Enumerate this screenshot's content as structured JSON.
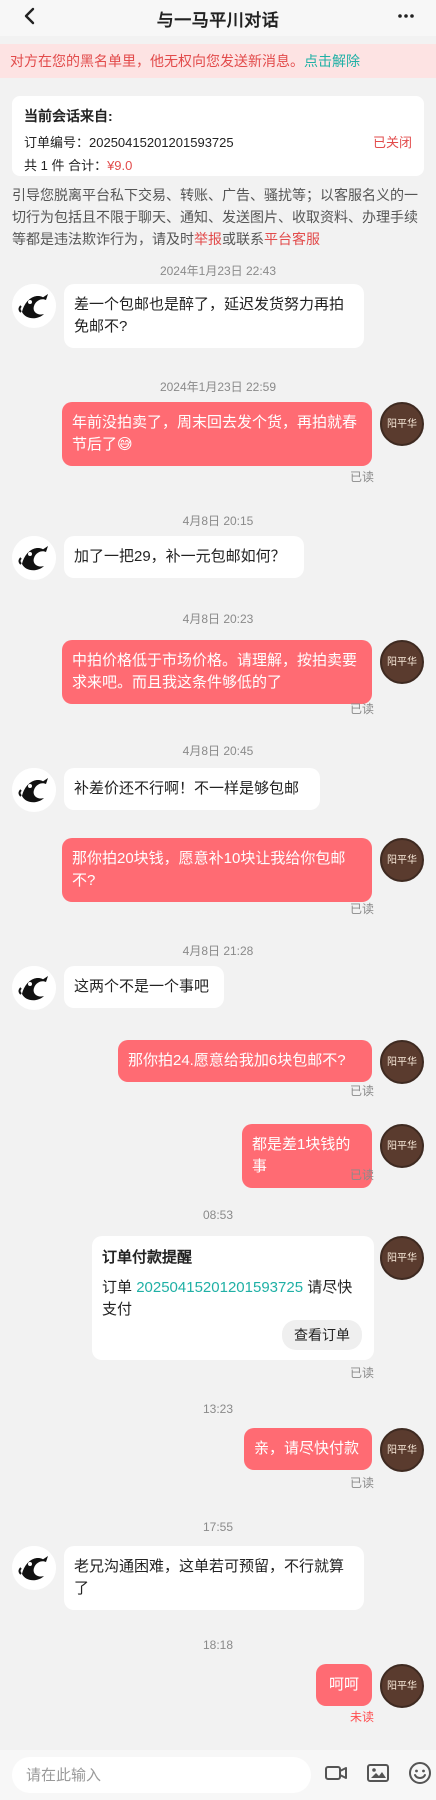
{
  "header": {
    "title": "与一马平川对话"
  },
  "banner": {
    "text": "对方在您的黑名单里，他无权向您发送新消息。",
    "action": "点击解除"
  },
  "order_card": {
    "source_label": "当前会话来自:",
    "order_no_label": "订单编号：",
    "order_no": "2025041520120159​3725",
    "status": "已关闭",
    "qty_total": "共 1 件 合计：",
    "price": "¥9.0"
  },
  "warning": {
    "text_1": "引导您脱离平台私下交易、转账、广告、骚扰等；以客服名义的一切行为包括且不限于聊天、通知、发送图片、收取资料、办理手续等都是违法欺诈行为，请及时",
    "report": "举报",
    "text_2": "或联系",
    "service": "平台客服"
  },
  "messages": [
    {
      "time": "2024年1月23日 22:43"
    },
    {
      "text": "差一个包邮也是醉了，延迟发货努力再拍免邮不?"
    },
    {
      "time": "2024年1月23日 22:59"
    },
    {
      "text": "年前没拍卖了，周末回去发个货，再拍就春节后了😅",
      "status": "已读"
    },
    {
      "time": "4月8日 20:15"
    },
    {
      "text": "加了一把29，补一元包邮如何？"
    },
    {
      "time": "4月8日 20:23"
    },
    {
      "text": "中拍价格低于市场价格。请理解，按拍卖要求来吧。而且我这条件够低的了",
      "status": "已读"
    },
    {
      "time": "4月8日 20:45"
    },
    {
      "text": "补差价还不行啊！不一样是够包邮"
    },
    {
      "text": "那你拍20块钱，愿意补10块让我给你包邮不?",
      "status": "已读"
    },
    {
      "time": "4月8日 21:28"
    },
    {
      "text": "这两个不是一个事吧"
    },
    {
      "text": "那你拍24.愿意给我加6块包邮不?",
      "status": "已读"
    },
    {
      "text": "都是差1块钱的事",
      "status": "已读"
    },
    {
      "time": "08:53"
    },
    {
      "reminder_title": "订单付款提醒",
      "reminder_prefix": "订单",
      "reminder_order": "2025041520120159​3725",
      "reminder_suffix": "请尽快支付",
      "reminder_button": "查看订单",
      "status": "已读"
    },
    {
      "time": "13:23"
    },
    {
      "text": "亲，请尽快付款",
      "status": "已读"
    },
    {
      "time": "17:55"
    },
    {
      "text": "老兄沟通困难，这单若可预留，不行就算了"
    },
    {
      "time": "18:18"
    },
    {
      "text": "呵呵",
      "status": "未读"
    }
  ],
  "input": {
    "placeholder": "请在此输入"
  },
  "avatars": {
    "seller_brand_text": "阳平华"
  },
  "colors": {
    "pink": "#ff6b73",
    "teal": "#1fb0a5",
    "banner": "#fde3e3"
  },
  "icons": [
    "back-icon",
    "more-icon",
    "video-icon",
    "image-icon",
    "emoji-icon",
    "dragon-avatar-icon",
    "brand-avatar-icon"
  ]
}
